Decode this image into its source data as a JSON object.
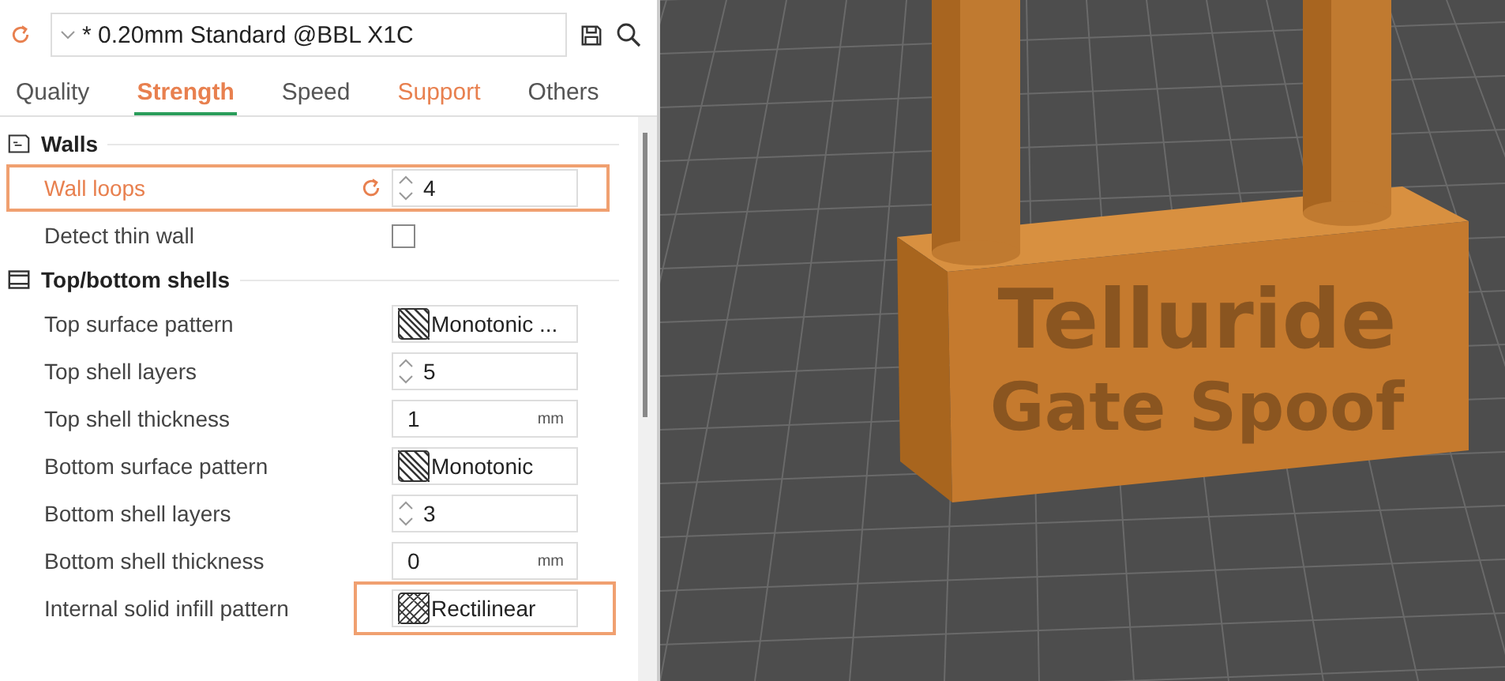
{
  "preset": {
    "value": "* 0.20mm Standard @BBL X1C"
  },
  "tabs": [
    {
      "label": "Quality",
      "selected": false,
      "modified": false
    },
    {
      "label": "Strength",
      "selected": true,
      "modified": true
    },
    {
      "label": "Speed",
      "selected": false,
      "modified": false
    },
    {
      "label": "Support",
      "selected": false,
      "modified": true
    },
    {
      "label": "Others",
      "selected": false,
      "modified": false
    }
  ],
  "groups": [
    {
      "title": "Walls",
      "kind": "walls",
      "options": [
        {
          "label": "Wall loops",
          "kind": "spin",
          "value": "4",
          "modified": true,
          "highlighted": true,
          "field_highlighted": false
        },
        {
          "label": "Detect thin wall",
          "kind": "checkbox",
          "checked": false,
          "modified": false,
          "highlighted": false,
          "field_highlighted": false
        }
      ]
    },
    {
      "title": "Top/bottom shells",
      "kind": "shells",
      "options": [
        {
          "label": "Top surface pattern",
          "kind": "monotonic",
          "value": "Monotonic ...",
          "modified": false,
          "highlighted": false,
          "field_highlighted": false
        },
        {
          "label": "Top shell layers",
          "kind": "spin",
          "value": "5",
          "modified": false,
          "highlighted": false,
          "field_highlighted": false
        },
        {
          "label": "Top shell thickness",
          "kind": "unit",
          "value": "1",
          "unit": "mm",
          "modified": false,
          "highlighted": false,
          "field_highlighted": false
        },
        {
          "label": "Bottom surface pattern",
          "kind": "monotonic",
          "value": "Monotonic",
          "modified": false,
          "highlighted": false,
          "field_highlighted": false
        },
        {
          "label": "Bottom shell layers",
          "kind": "spin",
          "value": "3",
          "modified": false,
          "highlighted": false,
          "field_highlighted": false
        },
        {
          "label": "Bottom shell thickness",
          "kind": "unit",
          "value": "0",
          "unit": "mm",
          "modified": false,
          "highlighted": false,
          "field_highlighted": false
        },
        {
          "label": "Internal solid infill pattern",
          "kind": "rectilinear",
          "value": "Rectilinear",
          "modified": false,
          "highlighted": false,
          "field_highlighted": true
        }
      ]
    }
  ],
  "viewport": {
    "model_text": [
      "Telluride",
      "Gate Spoof"
    ]
  }
}
